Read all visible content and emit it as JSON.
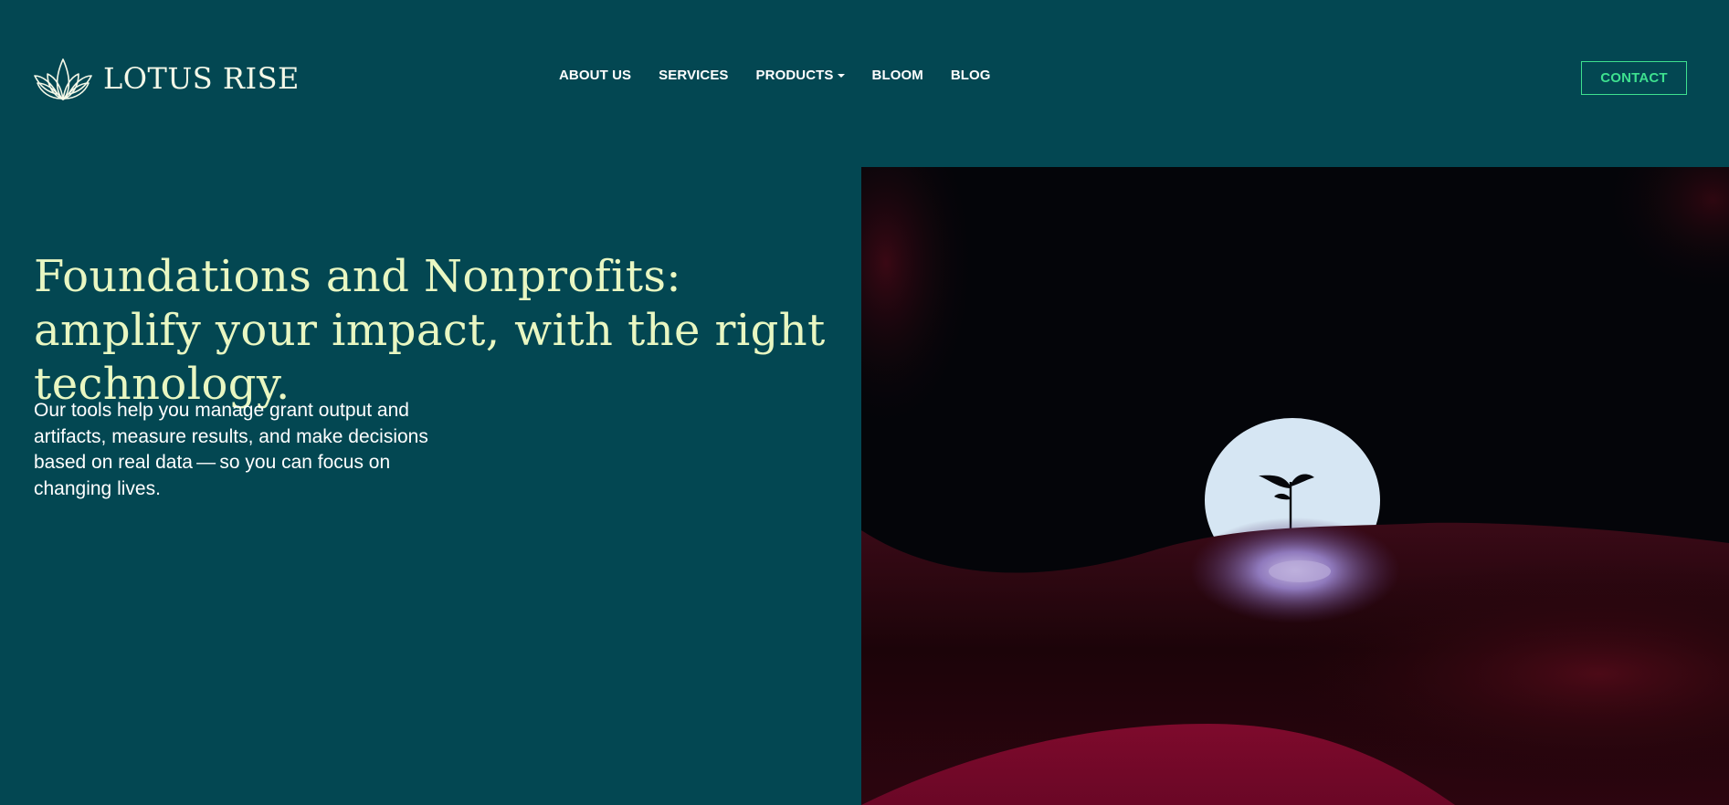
{
  "brand": {
    "name": "LOTUS RISE",
    "logo_icon": "lotus-icon"
  },
  "nav": {
    "items": [
      {
        "label": "ABOUT US",
        "has_dropdown": false
      },
      {
        "label": "SERVICES",
        "has_dropdown": false
      },
      {
        "label": "PRODUCTS",
        "has_dropdown": true
      },
      {
        "label": "BLOOM",
        "has_dropdown": false
      },
      {
        "label": "BLOG",
        "has_dropdown": false
      }
    ],
    "contact_label": "CONTACT"
  },
  "hero": {
    "title": "Foundations and Nonprofits: amplify your impact, with the right technology.",
    "body": "Our tools help you manage grant output and artifacts, measure results, and make decisions based on real data — so you can focus on changing lives."
  },
  "colors": {
    "background": "#034752",
    "title": "#e9f7c2",
    "accent": "#3ee08f",
    "nav_text": "#ffffff"
  }
}
